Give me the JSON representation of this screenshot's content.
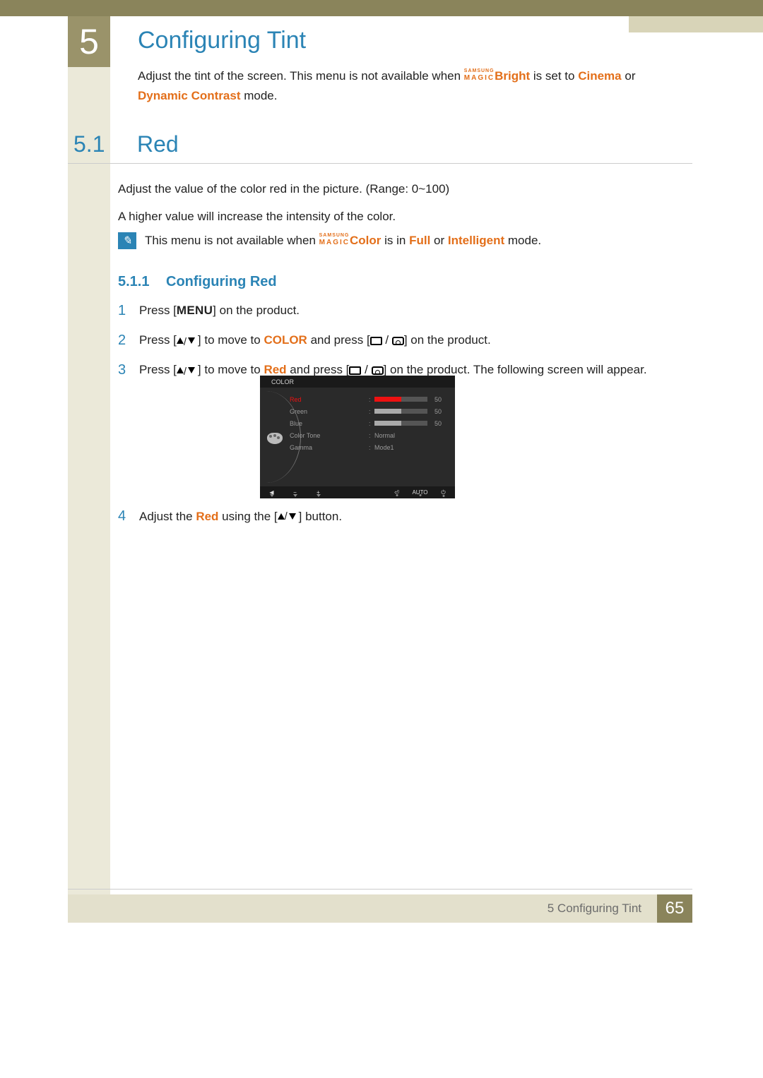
{
  "chapter": {
    "number": "5",
    "title": "Configuring Tint"
  },
  "intro": {
    "t1": "Adjust the tint of the screen. This menu is not available when ",
    "magic1": "MAGIC",
    "bright": "Bright",
    "t2": " is set to ",
    "cinema": "Cinema",
    "t3": " or ",
    "dyn": "Dynamic Contrast",
    "t4": " mode."
  },
  "section": {
    "num": "5.1",
    "title": "Red"
  },
  "para1": "Adjust the value of the color red in the picture. (Range: 0~100)",
  "para2": "A higher value will increase the intensity of the color.",
  "note": {
    "t1": "This menu is not available when ",
    "magic": "MAGIC",
    "color": "Color",
    "t2": " is in ",
    "full": "Full",
    "t3": " or ",
    "intel": "Intelligent",
    "t4": " mode."
  },
  "subsection": {
    "num": "5.1.1",
    "title": "Configuring Red"
  },
  "steps": {
    "s1": {
      "n": "1",
      "a": "Press [",
      "menu": "MENU",
      "b": "] on the product."
    },
    "s2": {
      "n": "2",
      "a": "Press [",
      "b": "] to move to ",
      "color": "COLOR",
      "c": " and press [",
      "d": "] on the product."
    },
    "s3": {
      "n": "3",
      "a": "Press [",
      "b": "] to move to ",
      "red": "Red",
      "c": " and press [",
      "d": "] on the product. The following screen will appear."
    },
    "s4": {
      "n": "4",
      "a": "Adjust the ",
      "red": "Red",
      "b": " using the [",
      "c": "] button."
    }
  },
  "osd": {
    "title": "COLOR",
    "rows": [
      {
        "label": "Red",
        "value": "50",
        "bar": true,
        "barClass": "red",
        "selected": true
      },
      {
        "label": "Green",
        "value": "50",
        "bar": true,
        "barClass": "grey"
      },
      {
        "label": "Blue",
        "value": "50",
        "bar": true,
        "barClass": "grey"
      },
      {
        "label": "Color Tone",
        "textValue": "Normal"
      },
      {
        "label": "Gamma",
        "textValue": "Mode1"
      }
    ],
    "footer": {
      "auto": "AUTO"
    }
  },
  "footer": {
    "text": "5 Configuring Tint",
    "page": "65"
  }
}
